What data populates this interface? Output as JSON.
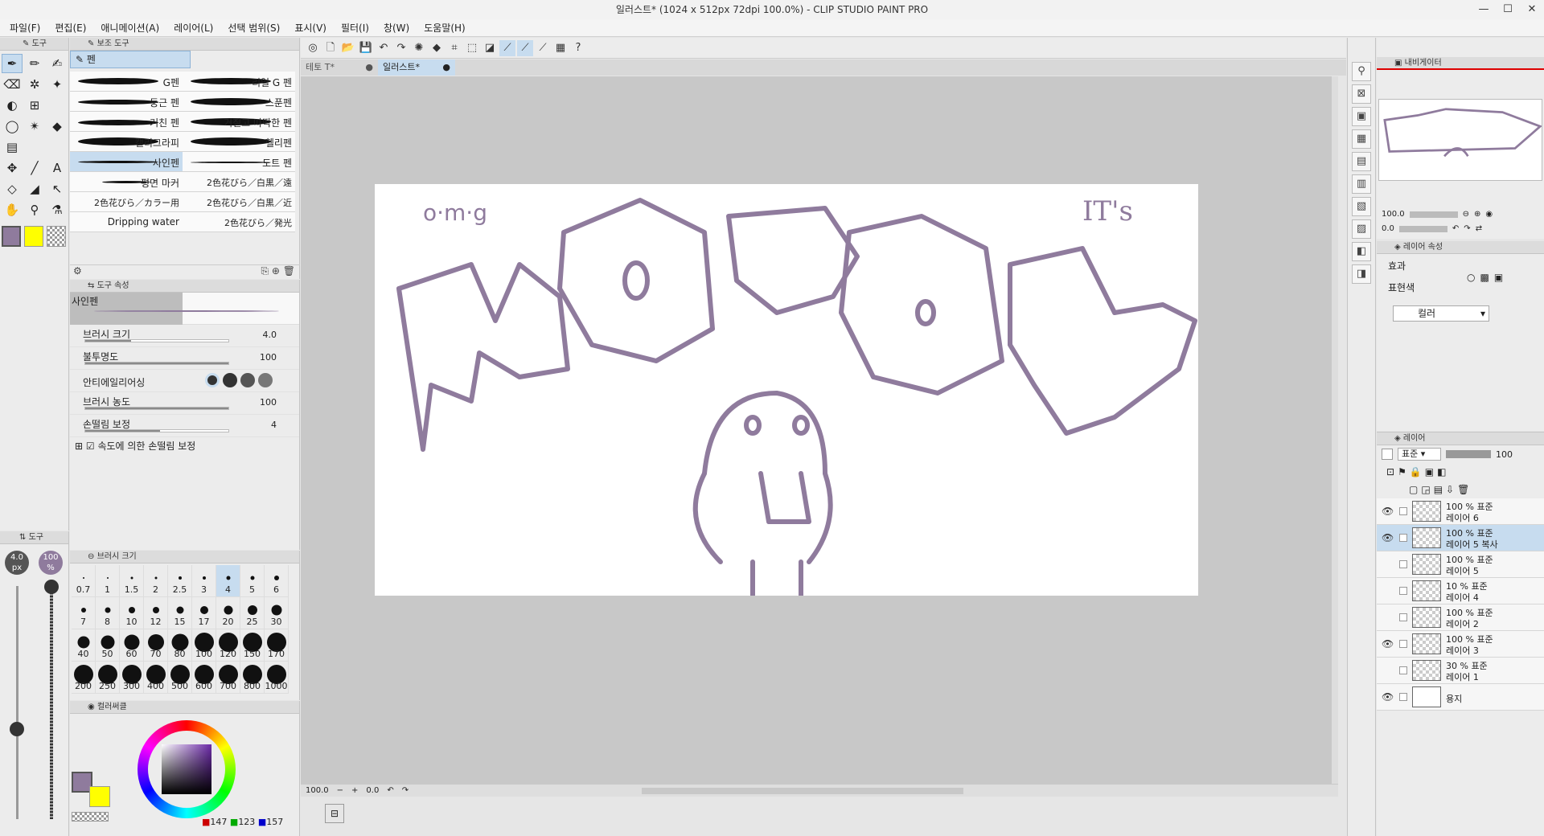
{
  "window": {
    "title": "일러스트* (1024 x 512px 72dpi 100.0%)  - CLIP STUDIO PAINT PRO",
    "min": "—",
    "max": "☐",
    "close": "✕"
  },
  "menu": [
    "파일(F)",
    "편집(E)",
    "애니메이션(A)",
    "레이어(L)",
    "선택 범위(S)",
    "표시(V)",
    "필터(I)",
    "창(W)",
    "도움말(H)"
  ],
  "tool_panel": {
    "tab": "도구",
    "subtool_tab": "보조 도구"
  },
  "subtool": {
    "group": "펜",
    "brushes": [
      {
        "label": "G펜"
      },
      {
        "label": "리얼 G 펜"
      },
      {
        "label": "둥근 펜"
      },
      {
        "label": "스푼펜"
      },
      {
        "label": "거친 펜"
      },
      {
        "label": "거칠고 따딱한 펜"
      },
      {
        "label": "캘리그라피"
      },
      {
        "label": "헬리펜"
      },
      {
        "label": "사인펜",
        "selected": true
      },
      {
        "label": "도트 펜"
      },
      {
        "label": "평면 마커"
      },
      {
        "label": "2色花びら／白黒／遠"
      },
      {
        "label": "2色花びら／カラー用"
      },
      {
        "label": "2色花びら／白黒／近"
      },
      {
        "label": "Dripping water"
      },
      {
        "label": "2色花びら／発光"
      }
    ]
  },
  "tool_property": {
    "tab": "도구 속성",
    "name": "사인펜",
    "brush_size": {
      "label": "브러시 크기",
      "value": "4.0",
      "fill": 0.32
    },
    "opacity": {
      "label": "불투명도",
      "value": "100",
      "fill": 1.0
    },
    "antialias": {
      "label": "안티에일리어싱"
    },
    "density": {
      "label": "브러시 농도",
      "value": "100",
      "fill": 1.0
    },
    "stabilization": {
      "label": "손떨림 보정",
      "value": "4",
      "fill": 0.52
    },
    "speed_stab": {
      "label": "속도에 의한 손떨림 보정"
    }
  },
  "size_indicator": {
    "size": "4.0",
    "unit": "px",
    "opacity": "100",
    "opacity_unit": "%",
    "tab": "도구"
  },
  "brush_size_panel": {
    "tab": "브러시 크기",
    "sizes": [
      "0.7",
      "1",
      "1.5",
      "2",
      "2.5",
      "3",
      "4",
      "5",
      "6",
      "7",
      "8",
      "10",
      "12",
      "15",
      "17",
      "20",
      "25",
      "30",
      "40",
      "50",
      "60",
      "70",
      "80",
      "100",
      "120",
      "150",
      "170",
      "200",
      "250",
      "300",
      "400",
      "500",
      "600",
      "700",
      "800",
      "1000"
    ],
    "selected": "4"
  },
  "color_panel": {
    "tab": "컬러써클",
    "main_color": "#8f7b9d",
    "sub_color": "#ffff00",
    "rgb_r": "147",
    "rgb_g": "123",
    "rgb_b": "157"
  },
  "doc_tabs": [
    {
      "label": "테토 T*",
      "close": "●"
    },
    {
      "label": "일러스트*",
      "close": "●"
    }
  ],
  "canvas": {
    "drawing": {
      "omg": "o·m·g",
      "its": "IT's"
    },
    "stroke_color": "#8f7b9d"
  },
  "status": {
    "zoom": "100.0",
    "angle": "0.0"
  },
  "navigator": {
    "tab": "내비게이터",
    "zoom": "100.0",
    "angle": "0.0"
  },
  "layer_property": {
    "tab": "레이어 속성",
    "effect": "효과",
    "expression_label": "표현색",
    "expression_value": "컬러"
  },
  "layer_panel": {
    "tab": "레이어",
    "blend": "표준",
    "opacity": "100",
    "layers": [
      {
        "line1": "100 % 표준",
        "line2": "레이어 6",
        "visible": true,
        "selected": false
      },
      {
        "line1": "100 % 표준",
        "line2": "레이어 5 복사",
        "visible": true,
        "selected": true
      },
      {
        "line1": "100 % 표준",
        "line2": "레이어 5",
        "visible": false,
        "selected": false
      },
      {
        "line1": "10 % 표준",
        "line2": "레이어 4",
        "visible": false,
        "selected": false
      },
      {
        "line1": "100 % 표준",
        "line2": "레이어 2",
        "visible": false,
        "selected": false
      },
      {
        "line1": "100 % 표준",
        "line2": "레이어 3",
        "visible": true,
        "selected": false
      },
      {
        "line1": "30 % 표준",
        "line2": "레이어 1",
        "visible": false,
        "selected": false
      },
      {
        "line1": "",
        "line2": "용지",
        "visible": true,
        "selected": false,
        "paper": true
      }
    ]
  }
}
